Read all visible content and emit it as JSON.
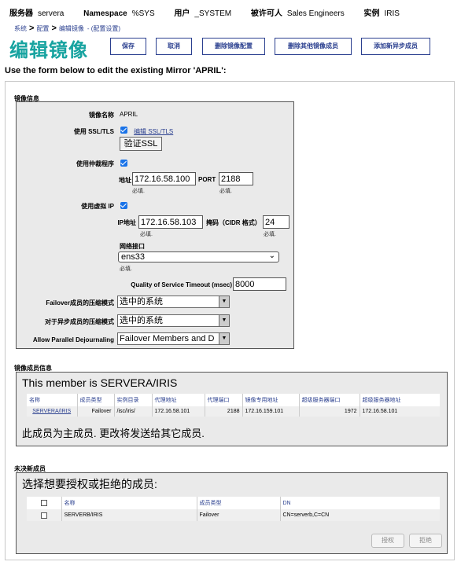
{
  "infobar": {
    "server_label": "服务器",
    "server_value": "servera",
    "ns_label": "Namespace",
    "ns_value": "%SYS",
    "user_label": "用户",
    "user_value": "_SYSTEM",
    "licensee_label": "被许可人",
    "licensee_value": "Sales Engineers",
    "instance_label": "实例",
    "instance_value": "IRIS"
  },
  "breadcrumb": {
    "item1": "系统",
    "item2": "配置",
    "item3": "编辑镜像",
    "suffix": "- (配置设置)"
  },
  "page_title": "编辑镜像",
  "toolbar": {
    "save": "保存",
    "cancel": "取消",
    "remove_config": "删除镜像配置",
    "remove_other": "删除其他镜像成员",
    "add_async": "添加新异步成员"
  },
  "intro": "Use the form below to edit the existing Mirror 'APRIL':",
  "mirror_info": {
    "section_title": "镜像信息",
    "name_label": "镜像名称",
    "name_value": "APRIL",
    "ssl_label": "使用 SSL/TLS",
    "ssl_checked": true,
    "ssl_edit_link": "编辑 SSL/TLS",
    "verify_ssl": "验证SSL",
    "arbiter_label": "使用仲裁程序",
    "arbiter_checked": true,
    "address_label": "地址",
    "address_value": "172.16.58.100",
    "port_label": "PORT",
    "port_value": "2188",
    "required": "必填.",
    "vip_label": "使用虚拟 IP",
    "vip_checked": true,
    "ip_label": "IP地址",
    "ip_value": "172.16.58.103",
    "mask_label": "掩码（CIDR 格式）",
    "mask_value": "24",
    "nic_label": "网络接口",
    "nic_value": "ens33",
    "qos_label": "Quality of Service Timeout (msec)",
    "qos_value": "8000",
    "failover_comp_label": "Failover成员的压缩模式",
    "failover_comp_value": "选中的系统",
    "async_comp_label": "对于异步成员的压缩模式",
    "async_comp_value": "选中的系统",
    "dejournal_label": "Allow Parallel Dejournaling",
    "dejournal_value": "Failover Members and D"
  },
  "member_info": {
    "section_title": "镜像成员信息",
    "headline": "This member is SERVERA/IRIS",
    "columns": [
      "名称",
      "成员类型",
      "实例目录",
      "代理地址",
      "代理端口",
      "镜像专用地址",
      "超级服务器端口",
      "超级服务器地址"
    ],
    "row": [
      "SERVERA/IRIS",
      "Failover",
      "/isc/iris/",
      "172.16.58.101",
      "2188",
      "172.16.159.101",
      "1972",
      "172.16.58.101"
    ],
    "note": "此成员为主成员. 更改将发送给其它成员."
  },
  "pending": {
    "section_title": "未决新成员",
    "headline": "选择想要授权或拒绝的成员:",
    "columns": [
      "名称",
      "成员类型",
      "DN"
    ],
    "row": [
      "SERVERB/IRIS",
      "Failover",
      "CN=serverb,C=CN"
    ],
    "authorize": "授权",
    "reject": "拒绝"
  }
}
